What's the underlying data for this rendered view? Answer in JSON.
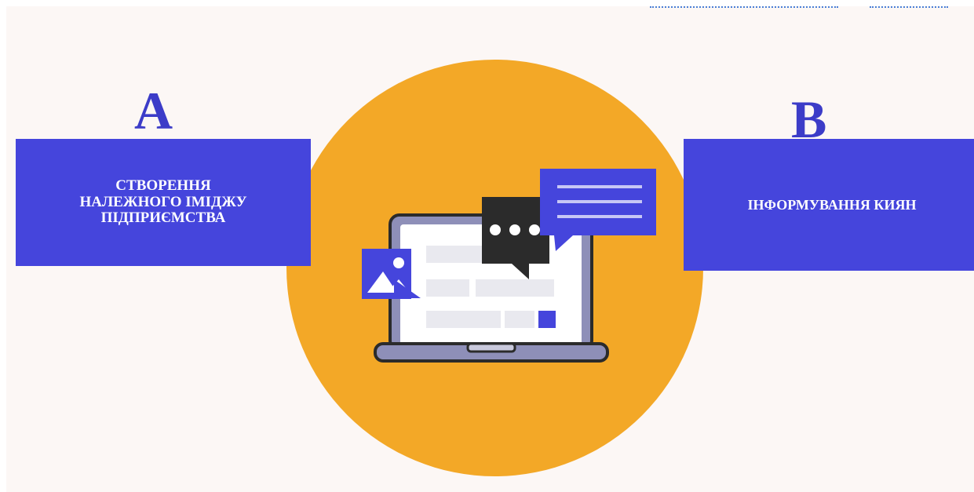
{
  "colors": {
    "accent_blue": "#4545dc",
    "circle_orange": "#f3a827",
    "letter_blue": "#3c3cc8",
    "dark": "#2b2b2b"
  },
  "diagram": {
    "left": {
      "letter": "A",
      "text": "СТВОРЕННЯ НАЛЕЖНОГО ІМІДЖУ ПІДПРИЄМСТВА"
    },
    "right": {
      "letter": "B",
      "text": "ІНФОРМУВАННЯ КИЯН"
    },
    "center_illustration": "laptop-with-chat-icon"
  }
}
